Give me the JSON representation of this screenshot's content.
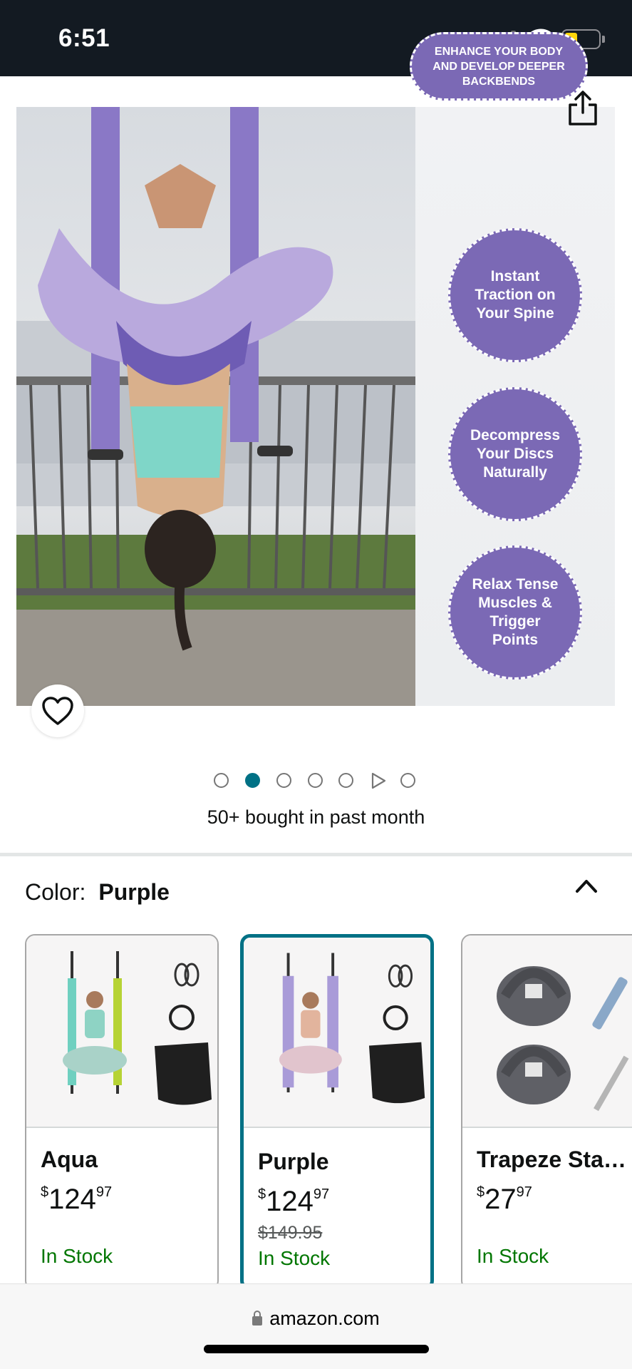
{
  "status_bar": {
    "time": "6:51",
    "icons": [
      "cellular-signal-icon",
      "wifi-icon",
      "battery-low-icon"
    ],
    "battery_color": "#ffd60a"
  },
  "product_image": {
    "callouts": [
      "ENHANCE YOUR BODY AND DEVELOP DEEPER BACKBENDS",
      "Instant Traction on Your Spine",
      "Decompress Your Discs Naturally",
      "Relax Tense Muscles & Trigger Points"
    ],
    "callout_color": "#7b69b5",
    "share_icon": "share-icon",
    "favorite_icon": "heart-outline-icon"
  },
  "carousel": {
    "slide_count": 7,
    "active_index": 1,
    "video_slide_index": 5
  },
  "social_proof": "50+ bought in past month",
  "color_selector": {
    "label": "Color:",
    "selected": "Purple",
    "toggle_icon": "chevron-up-icon"
  },
  "swatches": [
    {
      "name": "Aqua",
      "price_symbol": "$",
      "price_whole": "124",
      "price_fraction": "97",
      "was_price": "",
      "stock": "In Stock",
      "selected": false
    },
    {
      "name": "Purple",
      "price_symbol": "$",
      "price_whole": "124",
      "price_fraction": "97",
      "was_price": "$149.95",
      "stock": "In Stock",
      "selected": true
    },
    {
      "name": "Trapeze Sta…",
      "price_symbol": "$",
      "price_whole": "27",
      "price_fraction": "97",
      "was_price": "",
      "stock": "In Stock",
      "selected": false
    }
  ],
  "browser": {
    "url": "amazon.com"
  },
  "colors": {
    "accent_teal": "#007185",
    "in_stock_green": "#007600",
    "status_bar_bg": "#131a22"
  }
}
